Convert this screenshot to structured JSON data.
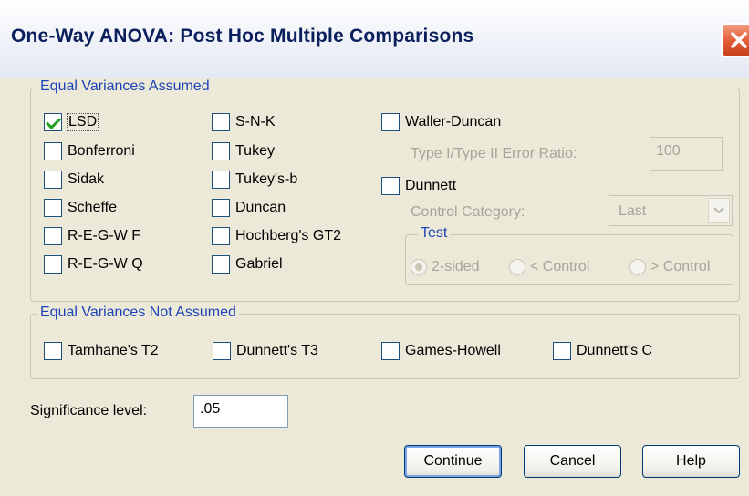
{
  "window": {
    "title": "One-Way ANOVA: Post Hoc Multiple Comparisons"
  },
  "equal_assumed": {
    "legend": "Equal Variances Assumed",
    "col1": [
      {
        "label": "LSD",
        "checked": true
      },
      {
        "label": "Bonferroni",
        "checked": false
      },
      {
        "label": "Sidak",
        "checked": false
      },
      {
        "label": "Scheffe",
        "checked": false
      },
      {
        "label": "R-E-G-W F",
        "checked": false
      },
      {
        "label": "R-E-G-W Q",
        "checked": false
      }
    ],
    "col2": [
      {
        "label": "S-N-K",
        "checked": false
      },
      {
        "label": "Tukey",
        "checked": false
      },
      {
        "label": "Tukey's-b",
        "checked": false
      },
      {
        "label": "Duncan",
        "checked": false
      },
      {
        "label": "Hochberg's GT2",
        "checked": false
      },
      {
        "label": "Gabriel",
        "checked": false
      }
    ],
    "waller": {
      "label": "Waller-Duncan",
      "checked": false
    },
    "error_ratio": {
      "label": "Type I/Type II Error Ratio:",
      "value": "100"
    },
    "dunnett": {
      "label": "Dunnett",
      "checked": false
    },
    "control_category": {
      "label": "Control Category:",
      "value": "Last"
    },
    "test": {
      "legend": "Test",
      "options": [
        {
          "label": "2-sided",
          "selected": true
        },
        {
          "label": "< Control",
          "selected": false
        },
        {
          "label": "> Control",
          "selected": false
        }
      ]
    }
  },
  "equal_not_assumed": {
    "legend": "Equal Variances Not Assumed",
    "items": [
      {
        "label": "Tamhane's T2",
        "checked": false
      },
      {
        "label": "Dunnett's T3",
        "checked": false
      },
      {
        "label": "Games-Howell",
        "checked": false
      },
      {
        "label": "Dunnett's C",
        "checked": false
      }
    ]
  },
  "significance": {
    "label": "Significance level:",
    "value": ".05"
  },
  "buttons": {
    "continue": "Continue",
    "cancel": "Cancel",
    "help": "Help"
  },
  "colors": {
    "title_text": "#0a1f5c",
    "legend_text": "#1d43b8",
    "check": "#21a121",
    "close_button": "#e25b33"
  }
}
